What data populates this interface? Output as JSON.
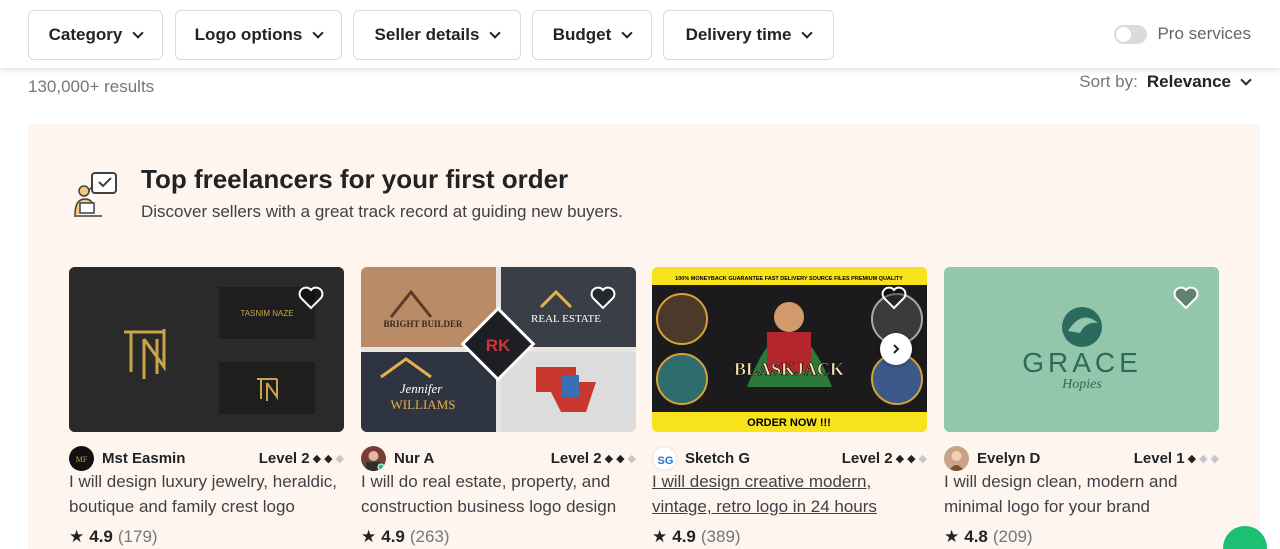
{
  "filters": {
    "category": "Category",
    "logo_options": "Logo options",
    "seller_details": "Seller details",
    "budget": "Budget",
    "delivery_time": "Delivery time",
    "pro_services": "Pro services"
  },
  "results_count": "130,000+ results",
  "sort": {
    "label": "Sort by:",
    "value": "Relevance"
  },
  "panel": {
    "title": "Top freelancers for your first order",
    "subtitle": "Discover sellers with a great track record at guiding new buyers."
  },
  "cards": [
    {
      "seller": "Mst Easmin",
      "level": "Level 2",
      "level_filled": 2,
      "title": "I will design luxury jewelry, heraldic, boutique and family crest logo",
      "rating": "4.9",
      "reviews": "(179)",
      "thumb_text_1": "TASNIM NAZE"
    },
    {
      "seller": "Nur A",
      "level": "Level 2",
      "level_filled": 2,
      "title": "I will do real estate, property, and construction business logo design",
      "rating": "4.9",
      "reviews": "(263)",
      "thumb_text_1": "BRIGHT BUILDER",
      "thumb_text_2": "REAL ESTATE",
      "thumb_text_3": "Jennifer",
      "thumb_text_4": "WILLIAMS",
      "thumb_text_5": "RK"
    },
    {
      "seller": "Sketch G",
      "level": "Level 2",
      "level_filled": 2,
      "title": "I will design creative modern, vintage, retro logo in 24 hours",
      "rating": "4.9",
      "reviews": "(389)",
      "thumb_banner": "100% MONEYBACK GUARANTEE   FAST DELIVERY   SOURCE FILES   PREMIUM QUALITY",
      "thumb_text_1": "BLASKJACK",
      "thumb_cta": "ORDER NOW !!!"
    },
    {
      "seller": "Evelyn D",
      "level": "Level 1",
      "level_filled": 1,
      "title": "I will design clean, modern and minimal logo for your brand",
      "rating": "4.8",
      "reviews": "(209)",
      "thumb_text_1": "GRACE",
      "thumb_text_2": "Hopies"
    }
  ],
  "colors": {
    "panel_bg": "#fdf5ee",
    "accent_green": "#1dbf73",
    "text_dark": "#222325",
    "text_muted": "#74767e"
  }
}
